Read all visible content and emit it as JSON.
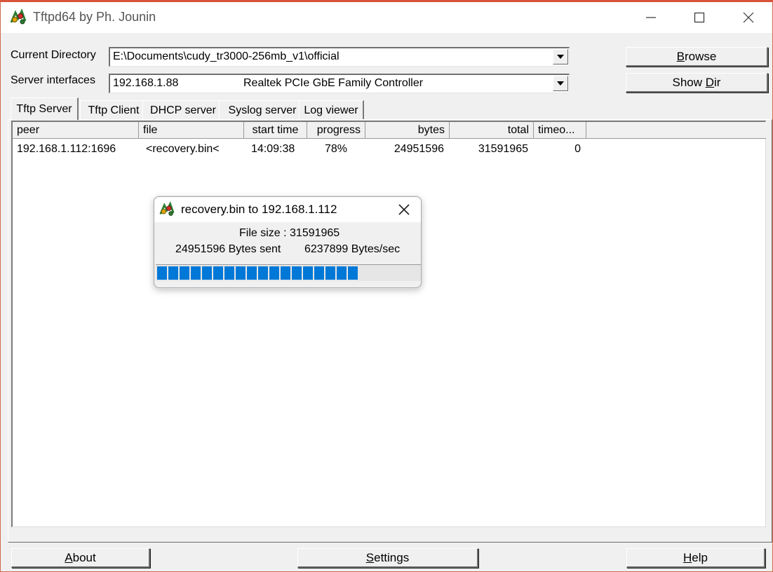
{
  "window": {
    "title": "Tftpd64 by Ph. Jounin",
    "icon": "tftpd64-app-icon",
    "controls": [
      "minimize-icon",
      "maximize-icon",
      "close-icon"
    ]
  },
  "fields": {
    "current_directory_label": "Current Directory",
    "current_directory_value": "E:\\Documents\\cudy_tr3000-256mb_v1\\official",
    "server_interfaces_label": "Server interfaces",
    "server_interfaces_ip": "192.168.1.88",
    "server_interfaces_adapter": "Realtek PCIe GbE Family Controller"
  },
  "buttons": {
    "browse": "Browse",
    "browse_mnemonic": "B",
    "browse_rest": "rowse",
    "show_dir_pre": "Show ",
    "show_dir_mnemonic": "D",
    "show_dir_rest": "ir",
    "about_mnemonic": "A",
    "about_rest": "bout",
    "settings_mnemonic": "S",
    "settings_rest": "ettings",
    "help_mnemonic": "H",
    "help_rest": "elp"
  },
  "tabs": [
    {
      "label": "Tftp Server",
      "active": true
    },
    {
      "label": "Tftp Client",
      "active": false
    },
    {
      "label": "DHCP server",
      "active": false
    },
    {
      "label": "Syslog server",
      "active": false
    },
    {
      "label": "Log viewer",
      "active": false
    }
  ],
  "table": {
    "columns": [
      "peer",
      "file",
      "start time",
      "progress",
      "bytes",
      "total",
      "timeo..."
    ],
    "rows": [
      {
        "peer": "192.168.1.112:1696",
        "file": "<recovery.bin<",
        "start_time": "14:09:38",
        "progress": "78%",
        "bytes": "24951596",
        "total": "31591965",
        "timeout": "0"
      }
    ]
  },
  "transfer_dialog": {
    "title": "recovery.bin to 192.168.1.112",
    "file_size": "File size : 31591965",
    "bytes_sent": "24951596 Bytes sent",
    "rate": "6237899 Bytes/sec",
    "progress_fraction": 0.79
  },
  "colors": {
    "progress_fill": "#0078d7",
    "title_bar_border": "#d9533a"
  }
}
